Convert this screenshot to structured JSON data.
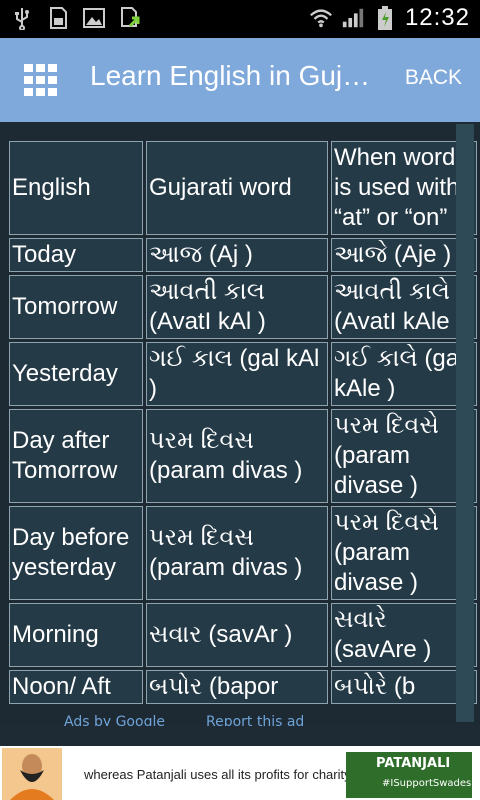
{
  "status_bar": {
    "time": "12:32",
    "icons": [
      "usb-icon",
      "sd-card-icon",
      "image-icon",
      "download-icon",
      "wifi-icon",
      "signal-icon",
      "battery-icon"
    ]
  },
  "app_bar": {
    "title": "Learn English in Guj…",
    "back_label": "BACK",
    "menu_icon": "grid-icon",
    "color": "#7fa9db"
  },
  "table": {
    "headers": [
      "English",
      "Gujarati word",
      "When word is used with “at” or “on”"
    ],
    "rows": [
      {
        "english": "Today",
        "gujarati": "આજ  (Aj )",
        "with_at_on": "આજે (Aje )"
      },
      {
        "english": "Tomorrow",
        "gujarati": "આવતી કાલ (AvatI kAl )",
        "with_at_on": "આવતી કાલે (AvatI kAle )"
      },
      {
        "english": "Yesterday",
        "gujarati": "ગઈ કાલ    (gal kAl  )",
        "with_at_on": "ગઈ કાલે (gal kAle )"
      },
      {
        "english": "Day after Tomorrow",
        "gujarati": "પરમ દિવસ (param divas )",
        "with_at_on": "પરમ દિવસે (param divase )"
      },
      {
        "english": "Day before yesterday",
        "gujarati": "પરમ દિવસ (param divas )",
        "with_at_on": "પરમ દિવસે (param divase )"
      },
      {
        "english": "Morning",
        "gujarati": "સવાર  (savAr )",
        "with_at_on": "સવારે (savAre )"
      },
      {
        "english": "Noon/ Aft",
        "gujarati": "બપોર  (bapor",
        "with_at_on": "બપોરે (b"
      }
    ]
  },
  "ad": {
    "links": [
      "Ads by Google",
      "Report this ad"
    ],
    "banner_text": "whereas Patanjali uses all its profits for charity in India.",
    "brand": "PATANJALI",
    "hashtag": "#ISupportSwadeshi"
  }
}
